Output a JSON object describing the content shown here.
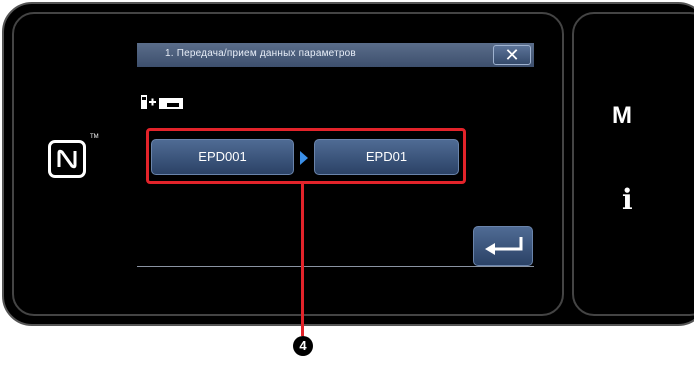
{
  "dialog": {
    "title": "1.  Передача/прием данных  параметров",
    "close_label": "✕"
  },
  "transfer": {
    "source_label": "EPD001",
    "destination_label": "EPD01"
  },
  "side_panel": {
    "m_label": "M",
    "info_label": "i"
  },
  "callout": {
    "number": "4"
  },
  "colors": {
    "callout": "#e3232a",
    "button": "#3a557d",
    "titlebar": "#4a5d7c",
    "arrow": "#3b8fe8"
  }
}
